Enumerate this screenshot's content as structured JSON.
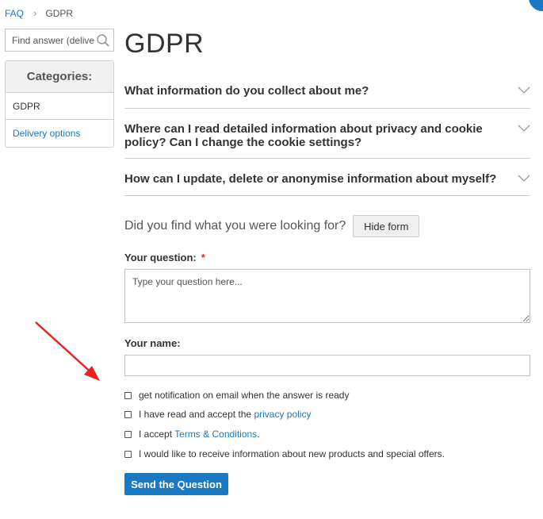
{
  "breadcrumbs": {
    "home": "FAQ",
    "separator": "›",
    "current": "GDPR"
  },
  "search": {
    "placeholder": "Find answer (delivery"
  },
  "sidebar": {
    "title": "Categories:",
    "items": [
      {
        "label": "GDPR",
        "active": true
      },
      {
        "label": "Delivery options",
        "active": false
      }
    ]
  },
  "page": {
    "title": "GDPR"
  },
  "faq": {
    "questions": [
      "What information do you collect about me?",
      "Where can I read detailed information about privacy and cookie policy? Can I change the cookie settings?",
      "How can I update, delete or anonymise information about myself?"
    ]
  },
  "form": {
    "ask_text": "Did you find what you were looking for?",
    "hide_label": "Hide form",
    "question_label": "Your question:",
    "required_mark": "*",
    "question_placeholder": "Type your question here...",
    "name_label": "Your name:",
    "name_value": "",
    "checkboxes": {
      "notify": "get notification on email when the answer is ready",
      "privacy_prefix": "I have read and accept the ",
      "privacy_link": "privacy policy",
      "terms_prefix": "I accept ",
      "terms_link": "Terms & Conditions",
      "terms_suffix": ".",
      "newsletter": "I would like to receive information about new products and special offers."
    },
    "submit_label": "Send the Question"
  },
  "colors": {
    "accent": "#1979c3",
    "required": "#e02b27",
    "annotation_arrow": "#e8231f"
  }
}
